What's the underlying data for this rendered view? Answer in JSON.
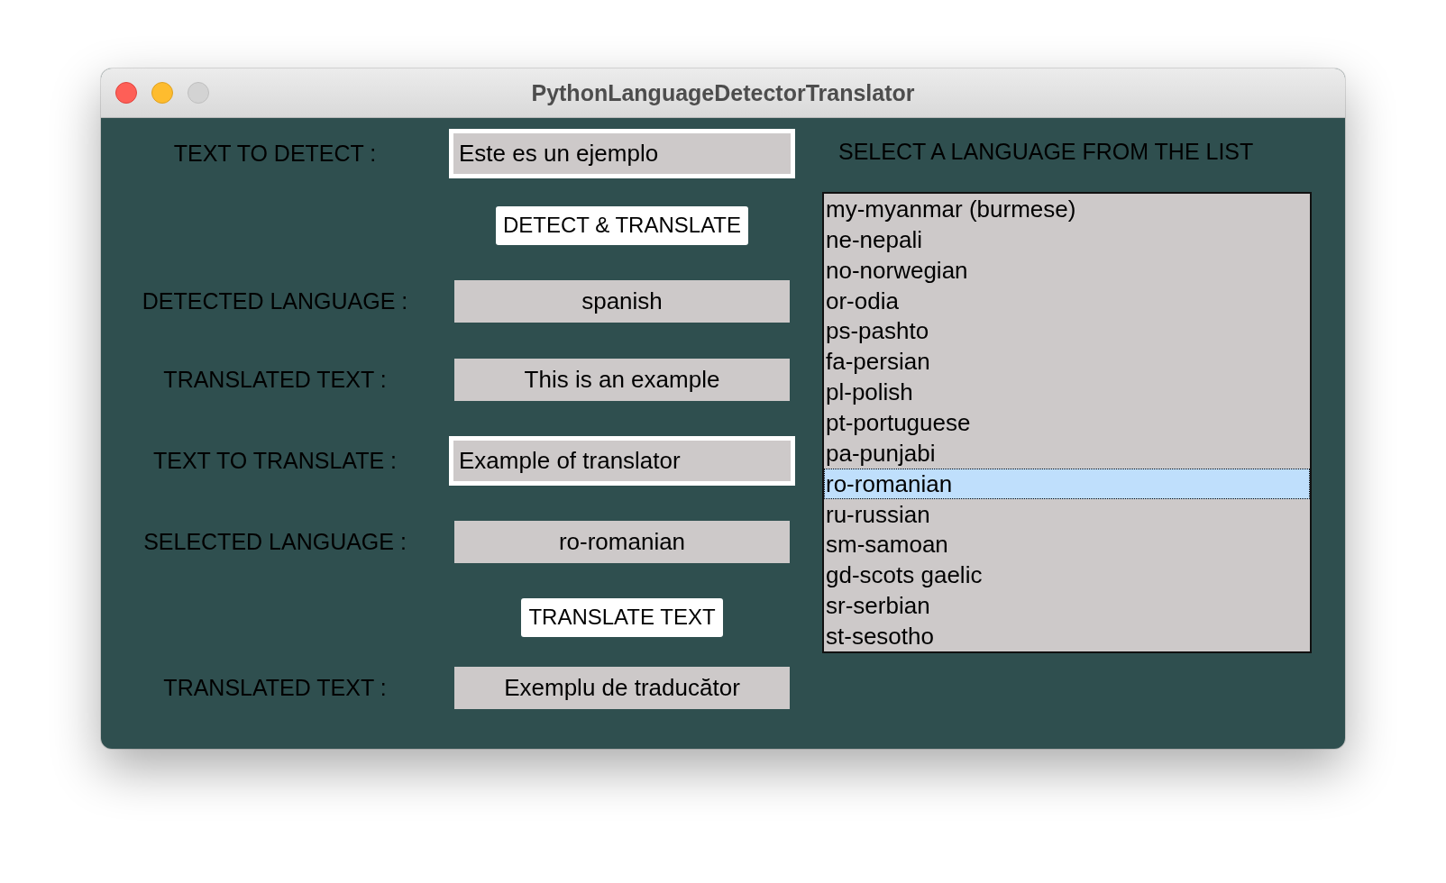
{
  "window": {
    "title": "PythonLanguageDetectorTranslator",
    "controls": [
      {
        "kind": "close",
        "disabled": false
      },
      {
        "kind": "minimize",
        "disabled": false
      },
      {
        "kind": "zoom",
        "disabled": true
      }
    ]
  },
  "form": [
    {
      "kind": "input",
      "label": "TEXT TO DETECT :",
      "value": "Este es un ejemplo"
    },
    {
      "kind": "button",
      "text": "DETECT & TRANSLATE"
    },
    {
      "kind": "output",
      "label": "DETECTED LANGUAGE :",
      "value": "spanish"
    },
    {
      "kind": "output",
      "label": "TRANSLATED TEXT :",
      "value": "This is an example"
    },
    {
      "kind": "input",
      "label": "TEXT TO TRANSLATE :",
      "value": "Example of translator"
    },
    {
      "kind": "output",
      "label": "SELECTED LANGUAGE :",
      "value": "ro-romanian"
    },
    {
      "kind": "button",
      "text": "TRANSLATE TEXT"
    },
    {
      "kind": "output",
      "label": "TRANSLATED TEXT :",
      "value": "Exemplu de traducător"
    }
  ],
  "language_list": {
    "title": "SELECT A LANGUAGE FROM THE LIST",
    "items": [
      {
        "label": "my-myanmar (burmese)",
        "selected": false
      },
      {
        "label": "ne-nepali",
        "selected": false
      },
      {
        "label": "no-norwegian",
        "selected": false
      },
      {
        "label": "or-odia",
        "selected": false
      },
      {
        "label": "ps-pashto",
        "selected": false
      },
      {
        "label": "fa-persian",
        "selected": false
      },
      {
        "label": "pl-polish",
        "selected": false
      },
      {
        "label": "pt-portuguese",
        "selected": false
      },
      {
        "label": "pa-punjabi",
        "selected": false
      },
      {
        "label": "ro-romanian",
        "selected": true
      },
      {
        "label": "ru-russian",
        "selected": false
      },
      {
        "label": "sm-samoan",
        "selected": false
      },
      {
        "label": "gd-scots gaelic",
        "selected": false
      },
      {
        "label": "sr-serbian",
        "selected": false
      },
      {
        "label": "st-sesotho",
        "selected": false
      }
    ]
  }
}
